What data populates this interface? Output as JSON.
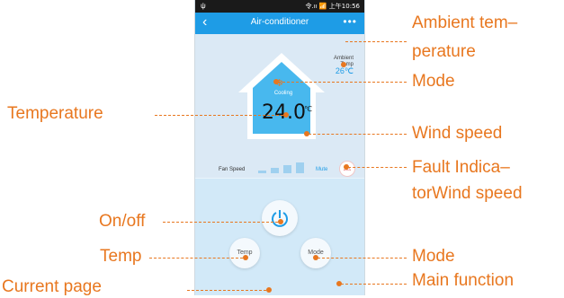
{
  "phone": {
    "status_bar": {
      "signal": "ψ",
      "right_text": "令.ıı 📶 上午10:56"
    },
    "app_bar": {
      "back": "‹",
      "title": "Air-conditioner",
      "more": "•••"
    },
    "ambient": {
      "label": "Ambient Temp",
      "value": "26℃"
    },
    "mode": {
      "label": "Cooling",
      "icon": "snowflake-icon"
    },
    "temperature": {
      "value": "24.0",
      "unit": "℃"
    },
    "fan": {
      "label": "Fan Speed",
      "level": "4 of 4 bars",
      "mute_label": "Mute"
    },
    "fault_icon": "fault-icon",
    "buttons": {
      "temp": "Temp",
      "mode": "Mode"
    },
    "pager": {
      "count": 2,
      "current": 1
    }
  },
  "callouts": {
    "ambient_temperature": "Ambient tem–perature",
    "mode_top": "Mode",
    "temperature": "Temperature",
    "wind_speed": "Wind speed",
    "fault_indicator": "Fault Indica–torWind speed",
    "on_off": "On/off",
    "temp": "Temp",
    "mode_bottom": "Mode",
    "main_function": "Main function",
    "current_page": "Current page"
  },
  "colors": {
    "accent": "#e8771f",
    "app_blue": "#1e9ce6"
  }
}
